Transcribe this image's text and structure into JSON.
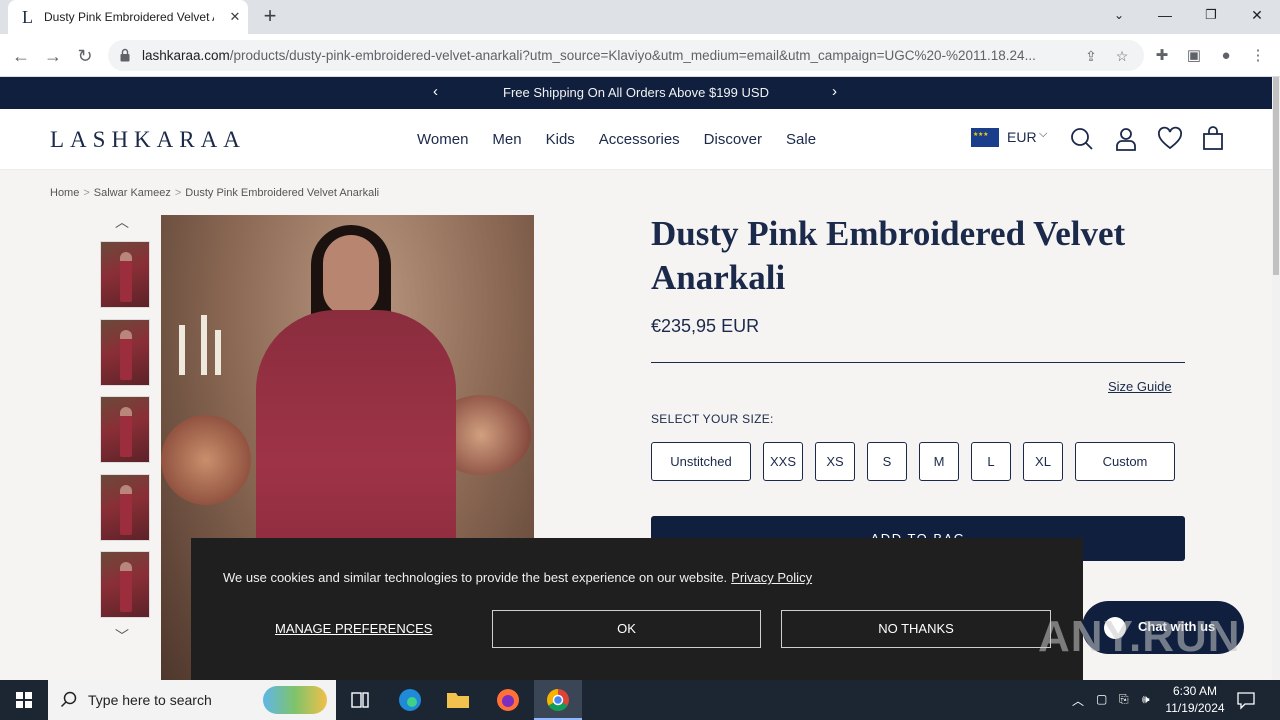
{
  "browser": {
    "tab_title": "Dusty Pink Embroidered Velvet A",
    "url_host": "lashkaraa.com",
    "url_path": "/products/dusty-pink-embroidered-velvet-anarkali?utm_source=Klaviyo&utm_medium=email&utm_campaign=UGC%20-%2011.18.24..."
  },
  "announcement": {
    "text": "Free Shipping On All Orders Above $199 USD"
  },
  "header": {
    "logo": "LASHKARAA",
    "nav": [
      "Women",
      "Men",
      "Kids",
      "Accessories",
      "Discover",
      "Sale"
    ],
    "currency": "EUR"
  },
  "breadcrumb": {
    "home": "Home",
    "category": "Salwar Kameez",
    "current": "Dusty Pink Embroidered Velvet Anarkali"
  },
  "product": {
    "title": "Dusty Pink Embroidered Velvet Anarkali",
    "price": "€235,95 EUR",
    "size_guide": "Size Guide",
    "select_size_label": "SELECT YOUR SIZE:",
    "sizes": [
      "Unstitched",
      "XXS",
      "XS",
      "S",
      "M",
      "L",
      "XL",
      "Custom"
    ],
    "add_to_bag": "ADD TO BAG"
  },
  "cookie": {
    "text": "We use cookies and similar technologies to provide the best experience on our website.",
    "privacy_link": "Privacy Policy",
    "manage": "MANAGE PREFERENCES",
    "ok": "OK",
    "no_thanks": "NO THANKS"
  },
  "chat": {
    "label": "Chat with us"
  },
  "watermark": "ANY.RUN",
  "taskbar": {
    "search_placeholder": "Type here to search",
    "time": "6:30 AM",
    "date": "11/19/2024"
  },
  "colors": {
    "navy": "#0f1f3d",
    "brand_text": "#1b2a4a",
    "cookie_bg": "#1f1f1f"
  }
}
